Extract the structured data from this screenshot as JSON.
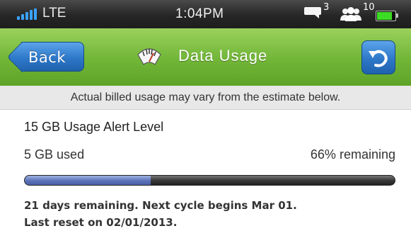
{
  "status_bar": {
    "carrier": "LTE",
    "time": "1:04PM",
    "message_count": "3",
    "contacts_count": "10",
    "battery_level": 0.85,
    "signal_color": "#3aa3ff",
    "battery_color": "#3ddc24"
  },
  "nav": {
    "back_label": "Back",
    "title": "Data Usage",
    "title_icon": "gauge-icon",
    "refresh_icon": "undo-icon",
    "accent_color": "#6fb535",
    "button_color": "#2e78c9"
  },
  "notice": "Actual billed usage may vary from the estimate below.",
  "usage": {
    "alert_title": "15 GB Usage Alert Level",
    "used_amount": "5 GB",
    "used_suffix": "used",
    "remaining_pct": "66%",
    "remaining_suffix": "remaining",
    "used_fraction": 0.34,
    "days_line": "21 days remaining. Next cycle begins Mar 01.",
    "reset_line": "Last reset on 02/01/2013."
  }
}
